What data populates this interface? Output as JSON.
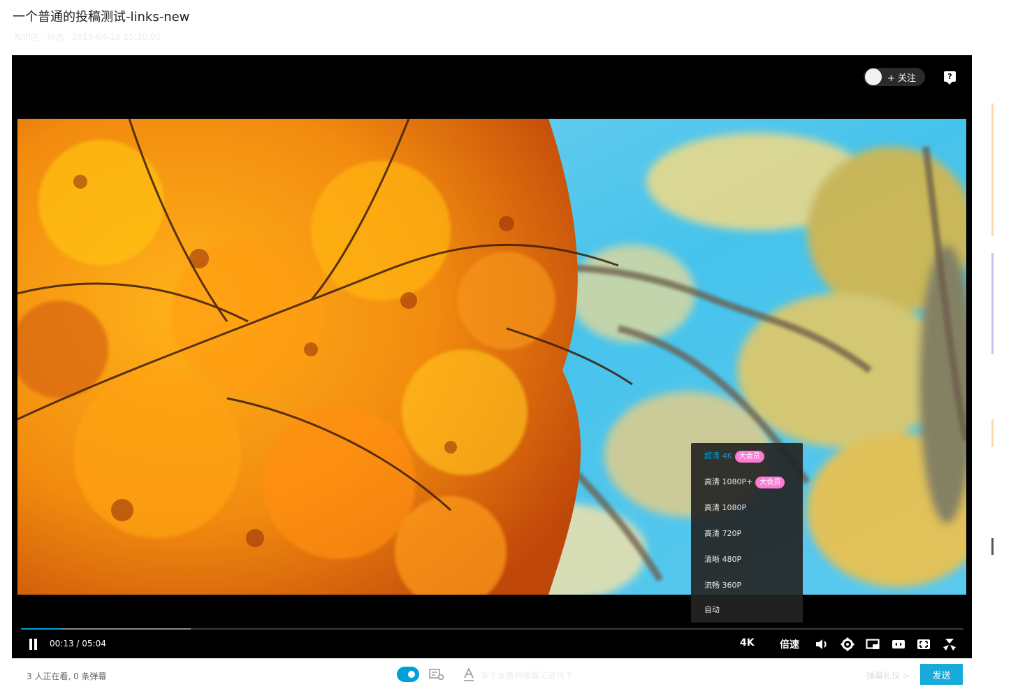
{
  "page": {
    "title": "一个普通的投稿测试-links-new",
    "meta": "知识区 · 动态 · 2019-04-19 15:30:00"
  },
  "player": {
    "follow_label": "+ 关注",
    "help_glyph": "?",
    "quality_menu": [
      {
        "label": "超清 4K",
        "badge": "大会员",
        "active": true
      },
      {
        "label": "高清 1080P+",
        "badge": "大会员",
        "active": false
      },
      {
        "label": "高清 1080P",
        "badge": "",
        "active": false
      },
      {
        "label": "高清 720P",
        "badge": "",
        "active": false
      },
      {
        "label": "清晰 480P",
        "badge": "",
        "active": false
      },
      {
        "label": "流畅 360P",
        "badge": "",
        "active": false
      },
      {
        "label": "自动",
        "badge": "",
        "active": false
      }
    ],
    "progress": {
      "played_fraction": 0.043,
      "buffered_fraction": 0.18
    },
    "time_display": "00:13 / 05:04",
    "quality_label": "4K",
    "speed_label": "倍速",
    "icons": [
      "pause-icon",
      "volume-icon",
      "gear-icon",
      "pip-icon",
      "wide-screen-icon",
      "web-fullscreen-icon",
      "fullscreen-icon"
    ]
  },
  "bottom_bar": {
    "viewers_text": "3 人正在看, 0 条弹幕",
    "danmaku_placeholder": "发个友善的弹幕见证当下",
    "etiquette_text": "弹幕礼仪 >",
    "send_label": "发送"
  },
  "colors": {
    "accent": "#00a1d6",
    "vip_badge": "#fb7cd3"
  }
}
